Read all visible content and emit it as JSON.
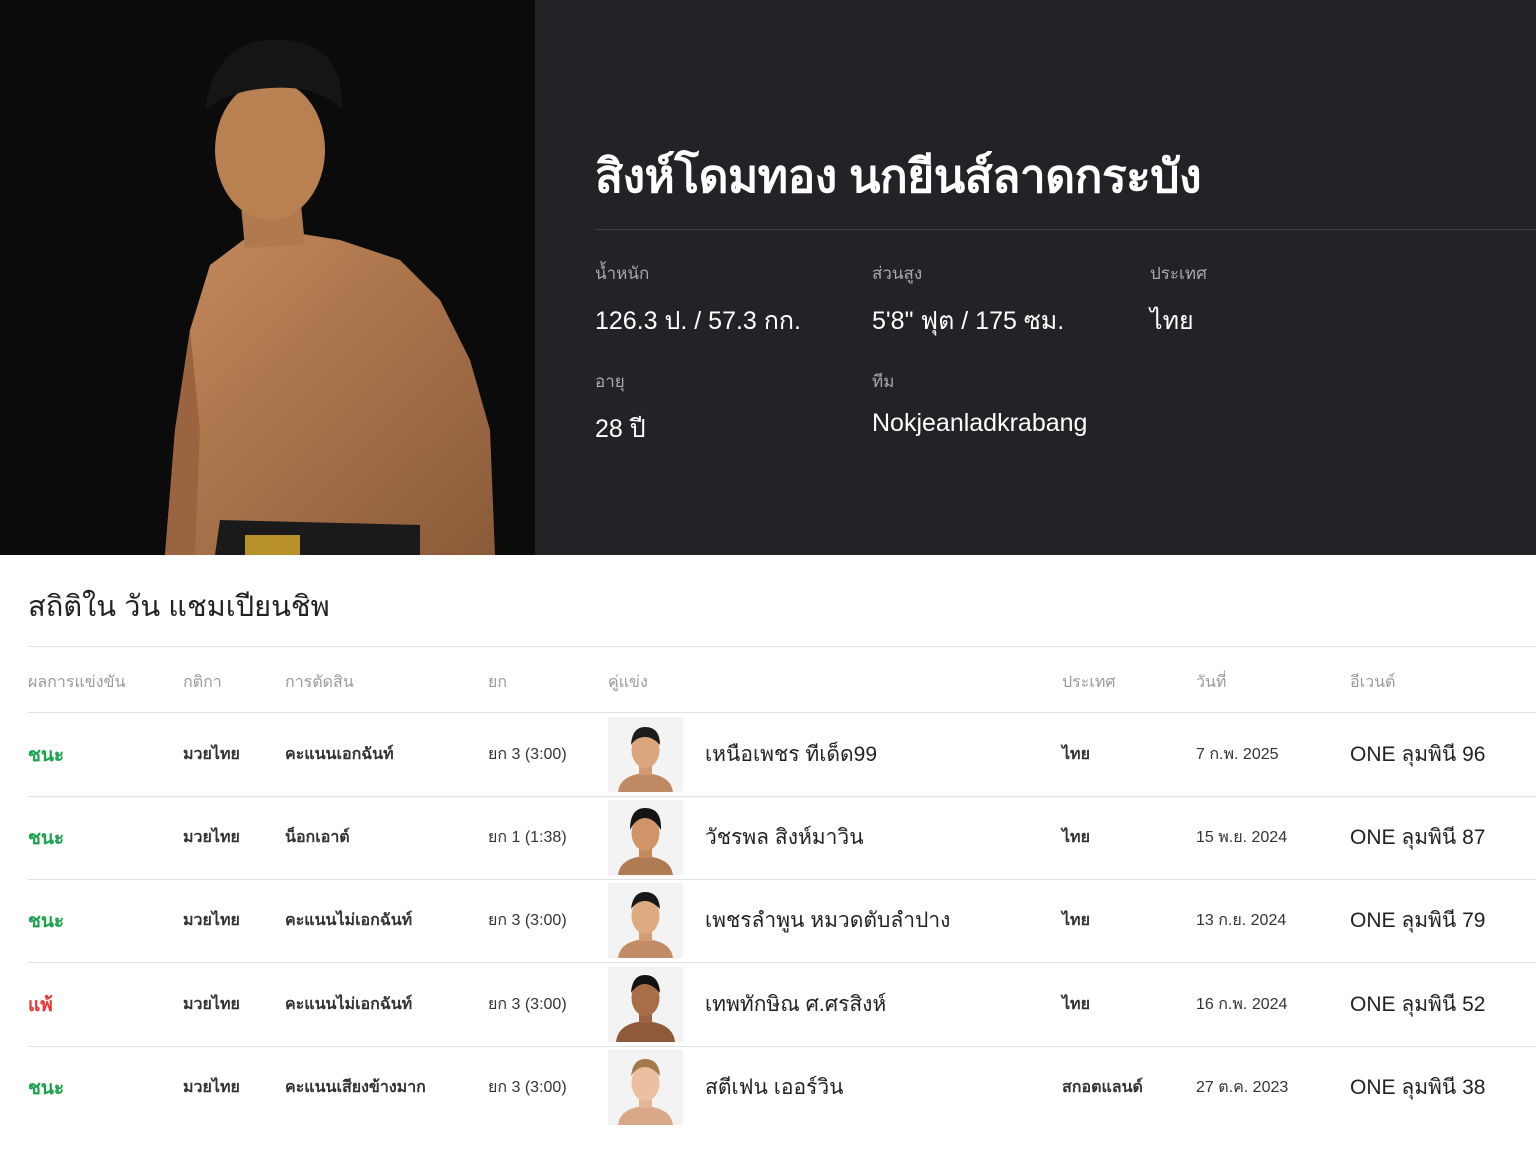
{
  "hero": {
    "name": "สิงห์โดมทอง นกยีนส์ลาดกระบัง",
    "attributes": [
      {
        "key": "weight",
        "label": "น้ำหนัก",
        "value": "126.3 ป. / 57.3 กก."
      },
      {
        "key": "height",
        "label": "ส่วนสูง",
        "value": "5'8\" ฟุต / 175 ซม."
      },
      {
        "key": "country",
        "label": "ประเทศ",
        "value": "ไทย"
      },
      {
        "key": "age",
        "label": "อายุ",
        "value": "28 ปี"
      },
      {
        "key": "team",
        "label": "ทีม",
        "value": "Nokjeanladkrabang"
      }
    ]
  },
  "stats": {
    "title": "สถิติใน วัน แชมเปียนชิพ",
    "headers": {
      "result": "ผลการแข่งขัน",
      "rules": "กติกา",
      "method": "การตัดสิน",
      "round": "ยก",
      "opponent": "คู่แข่ง",
      "country": "ประเทศ",
      "date": "วันที่",
      "event": "อีเวนต์"
    },
    "rows": [
      {
        "result": "ชนะ",
        "result_type": "win",
        "rules": "มวยไทย",
        "method": "คะแนนเอกฉันท์",
        "round": "ยก 3 (3:00)",
        "opponent": "เหนือเพชร ทีเด็ด99",
        "country": "ไทย",
        "date": "7 ก.พ. 2025",
        "event": "ONE ลุมพินี 96"
      },
      {
        "result": "ชนะ",
        "result_type": "win",
        "rules": "มวยไทย",
        "method": "น็อกเอาต์",
        "round": "ยก 1 (1:38)",
        "opponent": "วัชรพล สิงห์มาวิน",
        "country": "ไทย",
        "date": "15 พ.ย. 2024",
        "event": "ONE ลุมพินี 87"
      },
      {
        "result": "ชนะ",
        "result_type": "win",
        "rules": "มวยไทย",
        "method": "คะแนนไม่เอกฉันท์",
        "round": "ยก 3 (3:00)",
        "opponent": "เพชรลำพูน หมวดตับลำปาง",
        "country": "ไทย",
        "date": "13 ก.ย. 2024",
        "event": "ONE ลุมพินี 79"
      },
      {
        "result": "แพ้",
        "result_type": "loss",
        "rules": "มวยไทย",
        "method": "คะแนนไม่เอกฉันท์",
        "round": "ยก 3 (3:00)",
        "opponent": "เทพทักษิณ ศ.ศรสิงห์",
        "country": "ไทย",
        "date": "16 ก.พ. 2024",
        "event": "ONE ลุมพินี 52"
      },
      {
        "result": "ชนะ",
        "result_type": "win",
        "rules": "มวยไทย",
        "method": "คะแนนเสียงข้างมาก",
        "round": "ยก 3 (3:00)",
        "opponent": "สตีเฟน เออร์วิน",
        "country": "สกอตแลนด์",
        "date": "27 ต.ค. 2023",
        "event": "ONE ลุมพินี 38"
      }
    ]
  },
  "colors": {
    "win": "#1aa34a",
    "loss": "#e53935",
    "hero_bg": "#232327",
    "photo_bg": "#0b0b0c"
  },
  "icons": {
    "fighter_photo": "fighter-portrait",
    "opponent_thumb": "opponent-headshot"
  }
}
